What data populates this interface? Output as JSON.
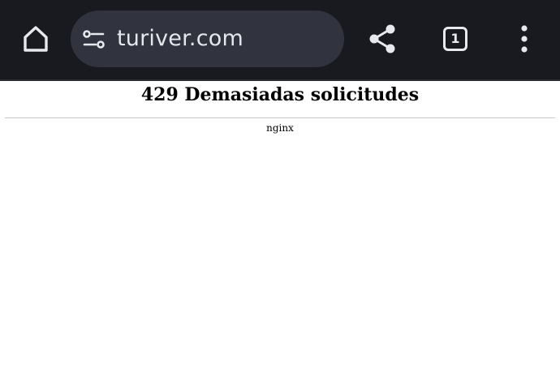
{
  "browser": {
    "address_bar": {
      "url": "turiver.com"
    },
    "tab_count": "1",
    "icons": {
      "home": "home-icon",
      "site_settings": "tune-icon",
      "share": "share-icon",
      "menu": "more-vert-icon"
    },
    "colors": {
      "toolbar_bg": "#181a1f",
      "omnibox_bg": "#31343f",
      "icon_fg": "#e8e9ee"
    }
  },
  "page": {
    "heading": "429 Demasiadas solicitudes",
    "server": "nginx"
  }
}
